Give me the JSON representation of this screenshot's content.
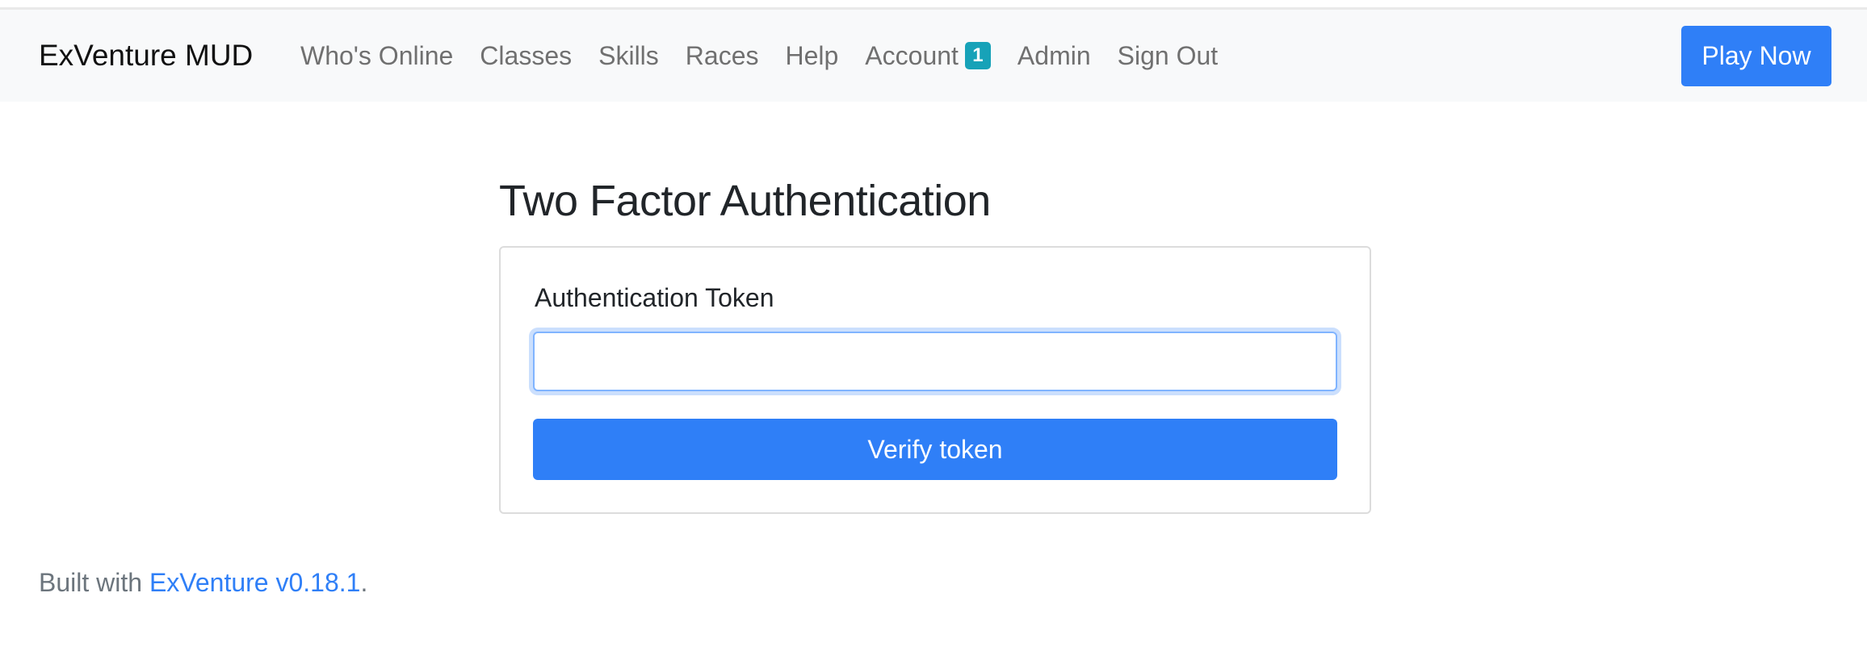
{
  "navbar": {
    "brand": "ExVenture MUD",
    "links": [
      {
        "label": "Who's Online"
      },
      {
        "label": "Classes"
      },
      {
        "label": "Skills"
      },
      {
        "label": "Races"
      },
      {
        "label": "Help"
      },
      {
        "label": "Account",
        "badge": "1"
      },
      {
        "label": "Admin"
      },
      {
        "label": "Sign Out"
      }
    ],
    "play_button": "Play Now"
  },
  "main": {
    "title": "Two Factor Authentication",
    "form": {
      "token_label": "Authentication Token",
      "token_value": "",
      "token_placeholder": "",
      "submit_label": "Verify token"
    }
  },
  "footer": {
    "prefix": "Built with ",
    "link_text": "ExVenture v0.18.1",
    "suffix": "."
  },
  "colors": {
    "primary": "#2f7ff7",
    "badge": "#17a2b8",
    "navbar_bg": "#f8f9fa",
    "nav_link": "#707070"
  }
}
